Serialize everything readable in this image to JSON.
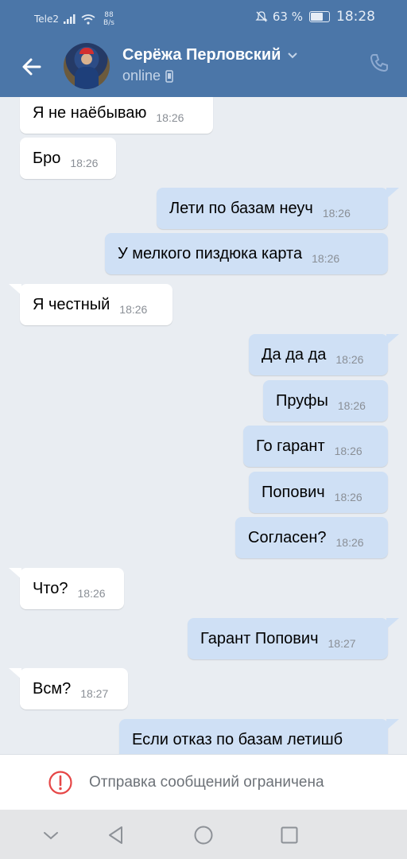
{
  "status_bar": {
    "carrier": "Tele2",
    "speed_value": "88",
    "speed_unit": "B/s",
    "battery": "63 %",
    "battery_level": 0.63,
    "time": "18:28",
    "icons": [
      "signal-icon",
      "wifi-icon",
      "mute-icon",
      "battery-icon"
    ]
  },
  "header": {
    "contact_name": "Серёжа Перловский",
    "status": "online",
    "icons": [
      "back-arrow-icon",
      "chevron-down-icon",
      "mobile-device-icon",
      "phone-icon"
    ]
  },
  "messages": [
    {
      "dir": "in",
      "text": "Я не наёбываю",
      "time": "18:26"
    },
    {
      "dir": "in",
      "text": "Бро",
      "time": "18:26"
    },
    {
      "dir": "out",
      "text": "Лети по базам неуч",
      "time": "18:26"
    },
    {
      "dir": "out",
      "text": "У мелкого пиздюка карта",
      "time": "18:26"
    },
    {
      "dir": "in",
      "text": "Я честный",
      "time": "18:26"
    },
    {
      "dir": "out",
      "text": "Да да да",
      "time": "18:26"
    },
    {
      "dir": "out",
      "text": "Пруфы",
      "time": "18:26"
    },
    {
      "dir": "out",
      "text": "Го гарант",
      "time": "18:26"
    },
    {
      "dir": "out",
      "text": "Попович",
      "time": "18:26"
    },
    {
      "dir": "out",
      "text": "Согласен?",
      "time": "18:26"
    },
    {
      "dir": "in",
      "text": "Что?",
      "time": "18:26"
    },
    {
      "dir": "out",
      "text": "Гарант Попович",
      "time": "18:27"
    },
    {
      "dir": "in",
      "text": "Всм?",
      "time": "18:27"
    },
    {
      "dir": "out",
      "text": "Если отказ по базам летишб",
      "time": ""
    }
  ],
  "restriction": {
    "text": "Отправка сообщений ограничена",
    "icon": "warning-icon",
    "color": "#e64646"
  },
  "colors": {
    "accent": "#4b76a8",
    "incoming_bubble": "#ffffff",
    "outgoing_bubble": "#cfe0f5",
    "background": "#e9edf2"
  },
  "nav_bar": {
    "icons": [
      "hide-keyboard-icon",
      "nav-back-icon",
      "nav-home-icon",
      "nav-recents-icon"
    ]
  }
}
